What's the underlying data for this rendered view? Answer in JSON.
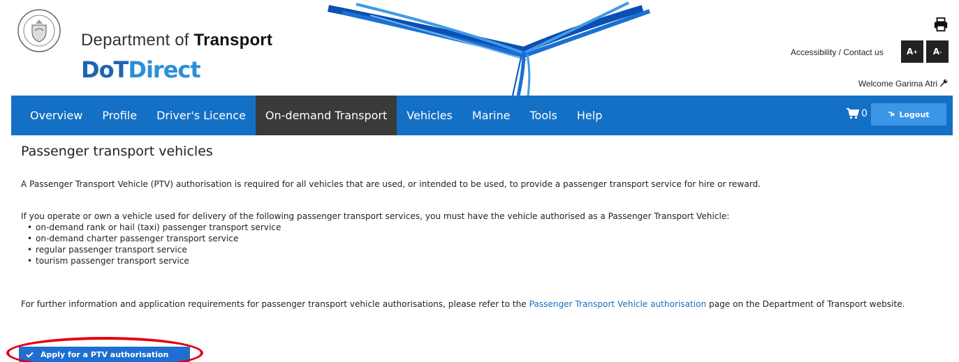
{
  "header": {
    "dept_prefix": "Department of ",
    "dept_bold": "Transport",
    "logo_dot": "DoT",
    "logo_direct": "Direct",
    "accessibility": "Accessibility / Contact us",
    "font_up": "A",
    "font_down": "A",
    "welcome": "Welcome Garima Atri",
    "print_icon": "printer-icon",
    "crest_icon": "wa-government-crest-icon",
    "wrench_icon": "wrench-icon"
  },
  "nav": {
    "items": [
      "Overview",
      "Profile",
      "Driver's Licence",
      "On-demand Transport",
      "Vehicles",
      "Marine",
      "Tools",
      "Help"
    ],
    "active": "On-demand Transport",
    "cart_count": "0",
    "logout": "Logout",
    "cart_icon": "cart-icon",
    "logout_icon": "logout-icon",
    "color": "#1470c4",
    "active_color": "#3a3a3a"
  },
  "main": {
    "title": "Passenger transport vehicles",
    "para1": "A Passenger Transport Vehicle (PTV) authorisation is required for all vehicles that are used, or intended to be used, to provide a passenger transport service for hire or reward.",
    "para2": "If you operate or own a vehicle used for delivery of the following passenger transport services, you must have the vehicle authorised as a Passenger Transport Vehicle:",
    "bullets": [
      "on-demand rank or hail (taxi) passenger transport service",
      "on-demand charter passenger transport service",
      "regular passenger transport service",
      "tourism passenger transport service"
    ],
    "para3_pre": "For further information and application requirements for passenger transport vehicle authorisations, please refer to the ",
    "para3_link": "Passenger Transport Vehicle authorisation",
    "para3_post": " page on the Department of Transport website.",
    "apply_button": "Apply for a PTV authorisation",
    "apply_icon": "check-icon",
    "highlight_color": "#e3000f"
  }
}
